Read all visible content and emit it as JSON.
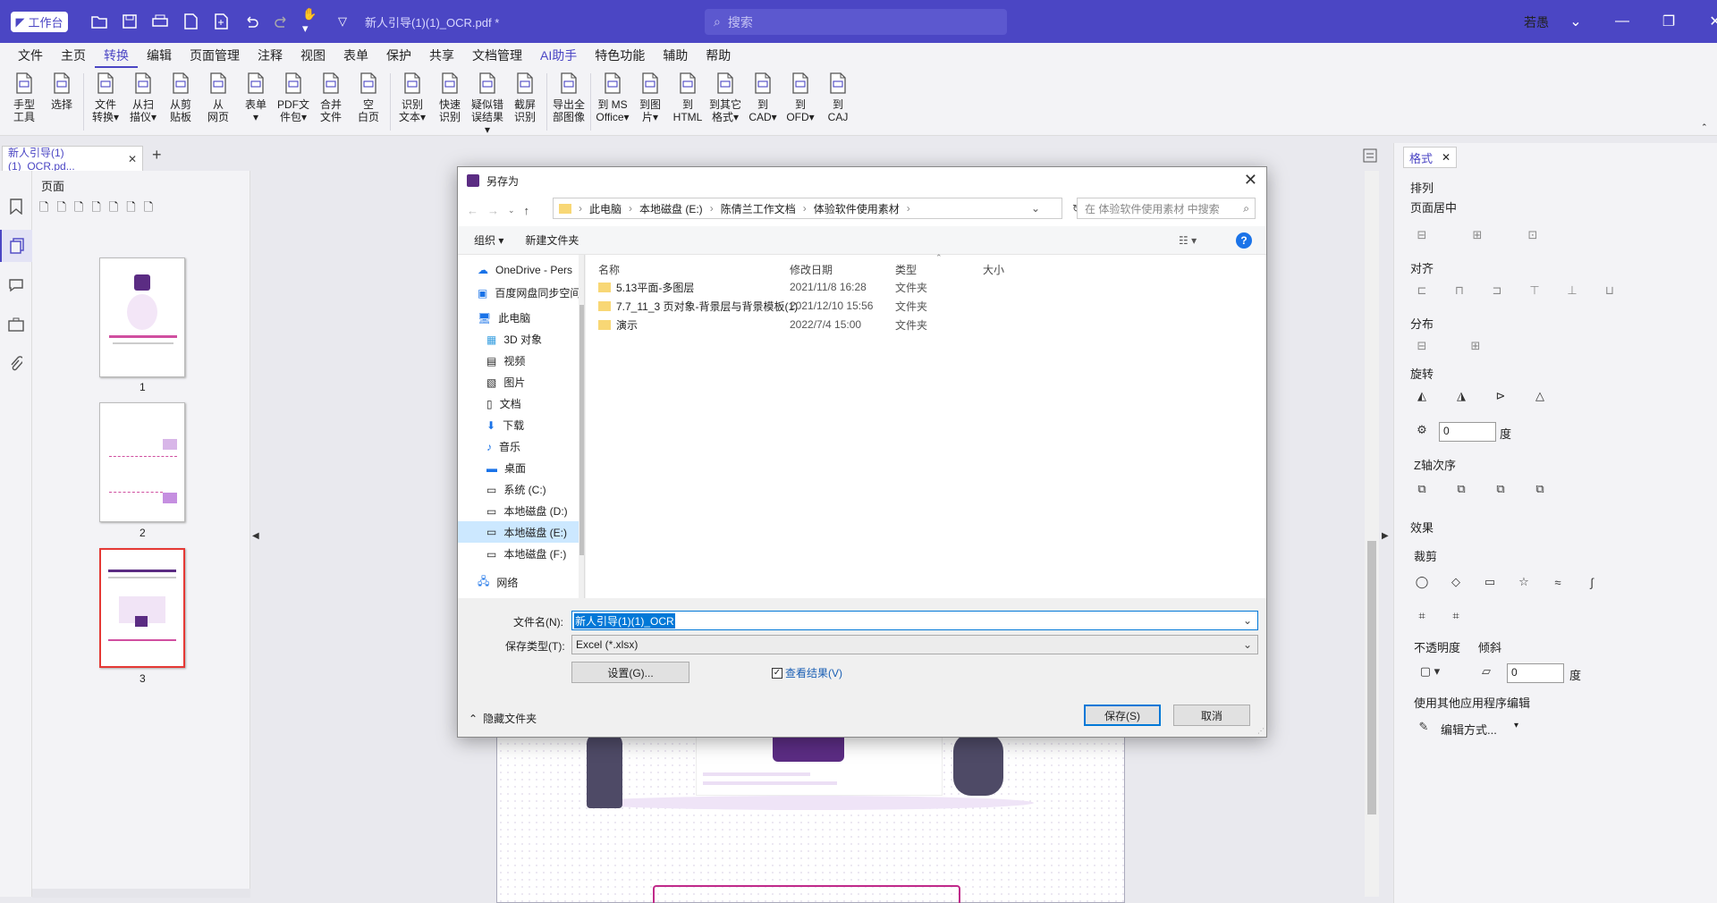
{
  "titlebar": {
    "workbench": "工作台",
    "doc_title": "新人引导(1)(1)_OCR.pdf *",
    "search_placeholder": "搜索",
    "user": "若愚"
  },
  "menu": [
    "文件",
    "主页",
    "转换",
    "编辑",
    "页面管理",
    "注释",
    "视图",
    "表单",
    "保护",
    "共享",
    "文档管理",
    "AI助手",
    "特色功能",
    "辅助",
    "帮助"
  ],
  "ribbon": [
    {
      "l1": "手型",
      "l2": "工具"
    },
    {
      "l1": "选择",
      "l2": ""
    },
    {
      "sep": true
    },
    {
      "l1": "文件",
      "l2": "转换▾"
    },
    {
      "l1": "从扫",
      "l2": "描仪▾"
    },
    {
      "l1": "从剪",
      "l2": "贴板"
    },
    {
      "l1": "从",
      "l2": "网页"
    },
    {
      "l1": "表单",
      "l2": "▾"
    },
    {
      "l1": "PDF文",
      "l2": "件包▾"
    },
    {
      "l1": "合并",
      "l2": "文件"
    },
    {
      "l1": "空",
      "l2": "白页"
    },
    {
      "sep": true
    },
    {
      "l1": "识别",
      "l2": "文本▾"
    },
    {
      "l1": "快速",
      "l2": "识别"
    },
    {
      "l1": "疑似错",
      "l2": "误结果▾"
    },
    {
      "l1": "截屏",
      "l2": "识别"
    },
    {
      "sep": true
    },
    {
      "l1": "导出全",
      "l2": "部图像"
    },
    {
      "sep": true
    },
    {
      "l1": "到 MS",
      "l2": "Office▾"
    },
    {
      "l1": "到图",
      "l2": "片▾"
    },
    {
      "l1": "到",
      "l2": "HTML"
    },
    {
      "l1": "到其它",
      "l2": "格式▾"
    },
    {
      "l1": "到",
      "l2": "CAD▾"
    },
    {
      "l1": "到",
      "l2": "OFD▾"
    },
    {
      "l1": "到",
      "l2": "CAJ"
    }
  ],
  "tab": {
    "name": "新人引导(1)(1)_OCR.pd...",
    "new": "+"
  },
  "thumbs": {
    "title": "页面",
    "pages": [
      "1",
      "2",
      "3"
    ]
  },
  "dialog": {
    "title": "另存为",
    "path": [
      "此电脑",
      "本地磁盘 (E:)",
      "陈倩兰工作文档",
      "体验软件使用素材"
    ],
    "search_placeholder": "在 体验软件使用素材 中搜索",
    "organize": "组织 ▾",
    "new_folder": "新建文件夹",
    "nav": [
      "OneDrive - Pers",
      "百度网盘同步空间",
      "此电脑",
      "3D 对象",
      "视频",
      "图片",
      "文档",
      "下载",
      "音乐",
      "桌面",
      "系统 (C:)",
      "本地磁盘 (D:)",
      "本地磁盘 (E:)",
      "本地磁盘 (F:)",
      "网络"
    ],
    "columns": [
      "名称",
      "修改日期",
      "类型",
      "大小"
    ],
    "files": [
      {
        "name": "5.13平面-多图层",
        "date": "2021/11/8 16:28",
        "type": "文件夹"
      },
      {
        "name": "7.7_11_3 页对象-背景层与背景模板(1)",
        "date": "2021/12/10 15:56",
        "type": "文件夹"
      },
      {
        "name": "演示",
        "date": "2022/7/4 15:00",
        "type": "文件夹"
      }
    ],
    "filename_label": "文件名(N):",
    "filename": "新人引导(1)(1)_OCR",
    "type_label": "保存类型(T):",
    "type_value": "Excel (*.xlsx)",
    "settings": "设置(G)...",
    "view_result": "查看结果(V)",
    "hide_folders": "隐藏文件夹",
    "save": "保存(S)",
    "cancel": "取消"
  },
  "rightpanel": {
    "tab": "格式",
    "arrange": "排列",
    "center": "页面居中",
    "align": "对齐",
    "distribute": "分布",
    "rotate": "旋转",
    "rotate_value": "0",
    "degree": "度",
    "zorder": "Z轴次序",
    "effects": "效果",
    "crop": "裁剪",
    "opacity": "不透明度",
    "skew": "倾斜",
    "skew_value": "0",
    "degree2": "度",
    "edit_other": "使用其他应用程序编辑",
    "edit_mode": "编辑方式..."
  }
}
